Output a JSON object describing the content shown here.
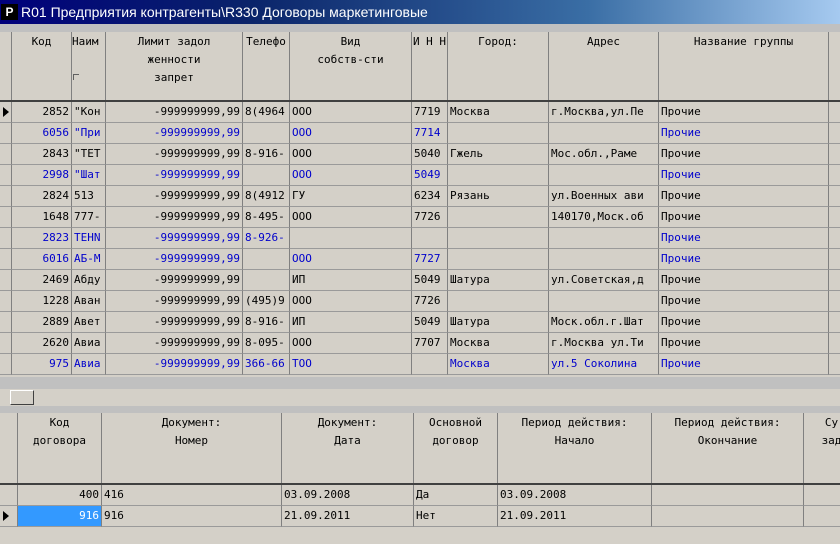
{
  "window": {
    "title": "R01 Предприятия контрагенты\\R330 Договоры маркетинговые",
    "icon": "Р"
  },
  "top_grid": {
    "columns": [
      "Код",
      "Наим",
      "Лимит задол\nженности\nзапрет",
      "Телефо",
      "Вид\nсобств-сти",
      "И Н Н",
      "Город:",
      "Адрес",
      "Название группы"
    ],
    "rows": [
      {
        "kod": "2852",
        "naim": "\"Кон",
        "limit": "-999999999,99",
        "tel": "8(4964",
        "vid": "ООО",
        "inn": "7719",
        "gorod": "Москва",
        "adres": "г.Москва,ул.Пе",
        "gruppa": "Прочие",
        "blue": false,
        "current": true
      },
      {
        "kod": "6056",
        "naim": "\"При",
        "limit": "-999999999,99",
        "tel": "",
        "vid": "ООО",
        "inn": "7714",
        "gorod": "",
        "adres": "",
        "gruppa": "Прочие",
        "blue": true,
        "current": false
      },
      {
        "kod": "2843",
        "naim": "\"ТЕТ",
        "limit": "-999999999,99",
        "tel": "8-916-",
        "vid": "ООО",
        "inn": "5040",
        "gorod": "Гжель",
        "adres": "Мос.обл.,Раме",
        "gruppa": "Прочие",
        "blue": false,
        "current": false
      },
      {
        "kod": "2998",
        "naim": "\"Шат",
        "limit": "-999999999,99",
        "tel": "",
        "vid": "ООО",
        "inn": "5049",
        "gorod": "",
        "adres": "",
        "gruppa": "Прочие",
        "blue": true,
        "current": false
      },
      {
        "kod": "2824",
        "naim": "513",
        "limit": "-999999999,99",
        "tel": "8(4912",
        "vid": "ГУ",
        "inn": "6234",
        "gorod": "Рязань",
        "adres": "ул.Военных ави",
        "gruppa": "Прочие",
        "blue": false,
        "current": false
      },
      {
        "kod": "1648",
        "naim": "777-",
        "limit": "-999999999,99",
        "tel": "8-495-",
        "vid": "ООО",
        "inn": "7726",
        "gorod": "",
        "adres": "140170,Моск.об",
        "gruppa": "Прочие",
        "blue": false,
        "current": false
      },
      {
        "kod": "2823",
        "naim": "TEHN",
        "limit": "-999999999,99",
        "tel": "8-926-",
        "vid": "",
        "inn": "",
        "gorod": "",
        "adres": "",
        "gruppa": "Прочие",
        "blue": true,
        "current": false
      },
      {
        "kod": "6016",
        "naim": "АБ-М",
        "limit": "-999999999,99",
        "tel": "",
        "vid": "ООО",
        "inn": "7727",
        "gorod": "",
        "adres": "",
        "gruppa": "Прочие",
        "blue": true,
        "current": false
      },
      {
        "kod": "2469",
        "naim": "Абду",
        "limit": "-999999999,99",
        "tel": "",
        "vid": "ИП",
        "inn": "5049",
        "gorod": "Шатура",
        "adres": "ул.Советская,д",
        "gruppa": "Прочие",
        "blue": false,
        "current": false
      },
      {
        "kod": "1228",
        "naim": "Аван",
        "limit": "-999999999,99",
        "tel": "(495)9",
        "vid": "ООО",
        "inn": "7726",
        "gorod": "",
        "adres": "",
        "gruppa": "Прочие",
        "blue": false,
        "current": false
      },
      {
        "kod": "2889",
        "naim": "Авет",
        "limit": "-999999999,99",
        "tel": "8-916-",
        "vid": "ИП",
        "inn": "5049",
        "gorod": "Шатура",
        "adres": "Моск.обл.г.Шат",
        "gruppa": "Прочие",
        "blue": false,
        "current": false
      },
      {
        "kod": "2620",
        "naim": "Авиа",
        "limit": "-999999999,99",
        "tel": "8-095-",
        "vid": "ООО",
        "inn": "7707",
        "gorod": "Москва",
        "adres": "г.Москва ул.Ти",
        "gruppa": "Прочие",
        "blue": false,
        "current": false
      },
      {
        "kod": "975",
        "naim": "Авиа",
        "limit": "-999999999,99",
        "tel": "366-66",
        "vid": "ТОО",
        "inn": "",
        "gorod": "Москва",
        "adres": "ул.5 Соколина",
        "gruppa": "Прочие",
        "blue": true,
        "current": false
      }
    ]
  },
  "bottom_grid": {
    "columns": [
      "Код\nдоговора",
      "Документ:\nНомер",
      "Документ:\nДата",
      "Основной\nдоговор",
      "Период действия:\nНачало",
      "Период действия:\nОкончание",
      "Су\nзад"
    ],
    "rows": [
      {
        "kod": "400",
        "nomer": "416",
        "data": "03.09.2008",
        "osn": "Да",
        "nachalo": "03.09.2008",
        "okonch": "",
        "current": false
      },
      {
        "kod": "916",
        "nomer": "916",
        "data": "21.09.2011",
        "osn": "Нет",
        "nachalo": "21.09.2011",
        "okonch": "",
        "current": true
      }
    ]
  },
  "colors": {
    "title_start": "#00007b",
    "title_end": "#a6caf0",
    "link_blue": "#0000cc",
    "selection": "#3399ff",
    "grid_bg": "#d4d0c8"
  },
  "icons": {
    "row_indicator": "triangle-right-icon",
    "sort_marker": "sort-corner-icon"
  }
}
